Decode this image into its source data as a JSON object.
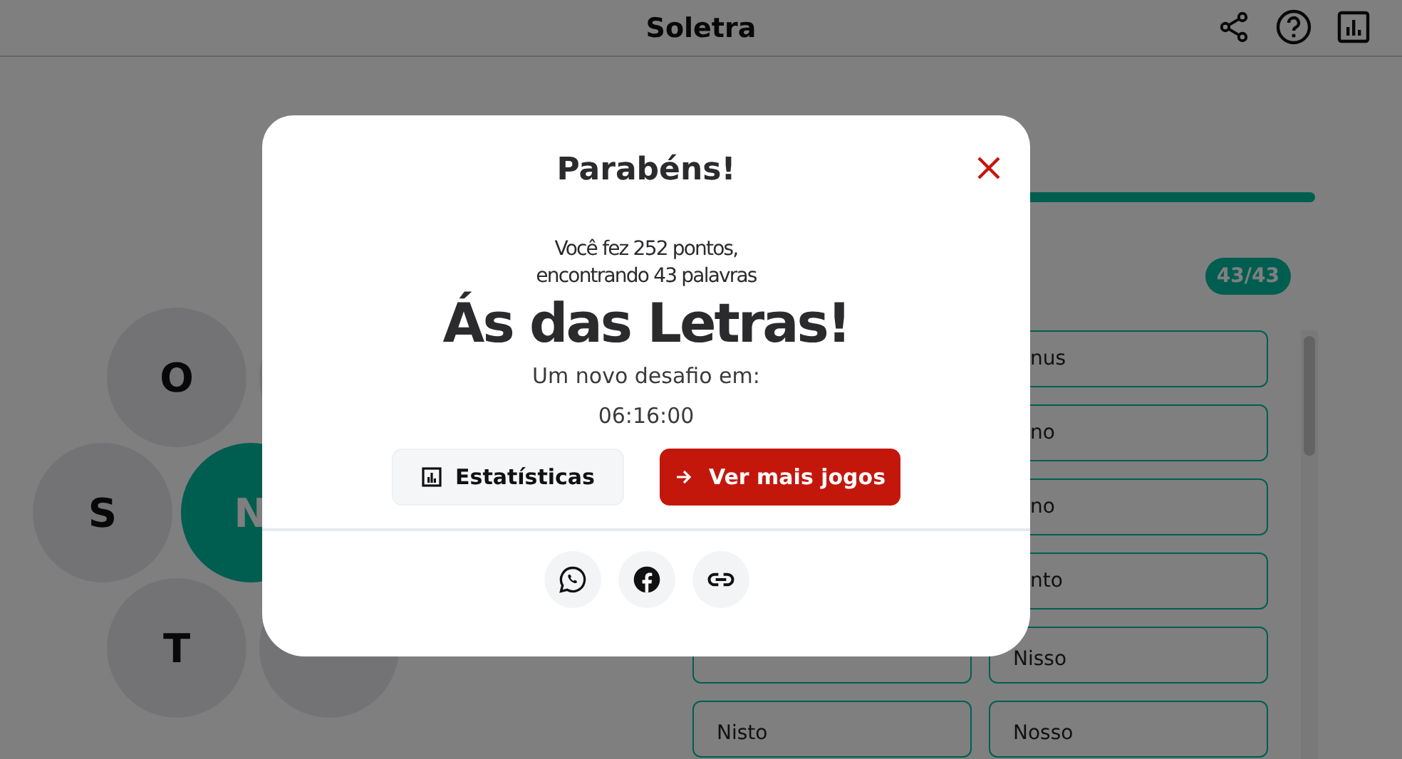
{
  "header": {
    "title": "Soletra"
  },
  "hexes": [
    {
      "letter": "O",
      "kind": "outer"
    },
    {
      "kind": "outer"
    },
    {
      "letter": "S",
      "kind": "outer"
    },
    {
      "letter": "N",
      "kind": "center"
    },
    {
      "letter": "T",
      "kind": "outer"
    },
    {
      "kind": "outer"
    }
  ],
  "progress": {
    "level": 1
  },
  "count_badge": "43/43",
  "words_left": [
    {
      "kind": "covered"
    },
    {
      "kind": "word",
      "text": "Nisto"
    }
  ],
  "words_right": [
    {
      "kind": "clipped",
      "text": "nus"
    },
    {
      "kind": "clipped",
      "text": "no"
    },
    {
      "kind": "clipped",
      "text": "no"
    },
    {
      "kind": "clipped",
      "text": "nto"
    },
    {
      "kind": "word",
      "text": "Nisso"
    },
    {
      "kind": "word",
      "text": "Nosso"
    }
  ],
  "modal": {
    "title": "Parabéns!",
    "summary": "Você fez 252 pontos,\nencontrando 43 palavras",
    "rank": "Ás das Letras!",
    "next_label": "Um novo desafio em:",
    "countdown": "06:16:00",
    "buttons": [
      {
        "label": "Estatísticas",
        "kind": "secondary"
      },
      {
        "label": "Ver mais jogos",
        "kind": "primary"
      }
    ],
    "share": [
      {
        "kind": "whatsapp"
      },
      {
        "kind": "facebook"
      },
      {
        "kind": "link"
      }
    ]
  }
}
